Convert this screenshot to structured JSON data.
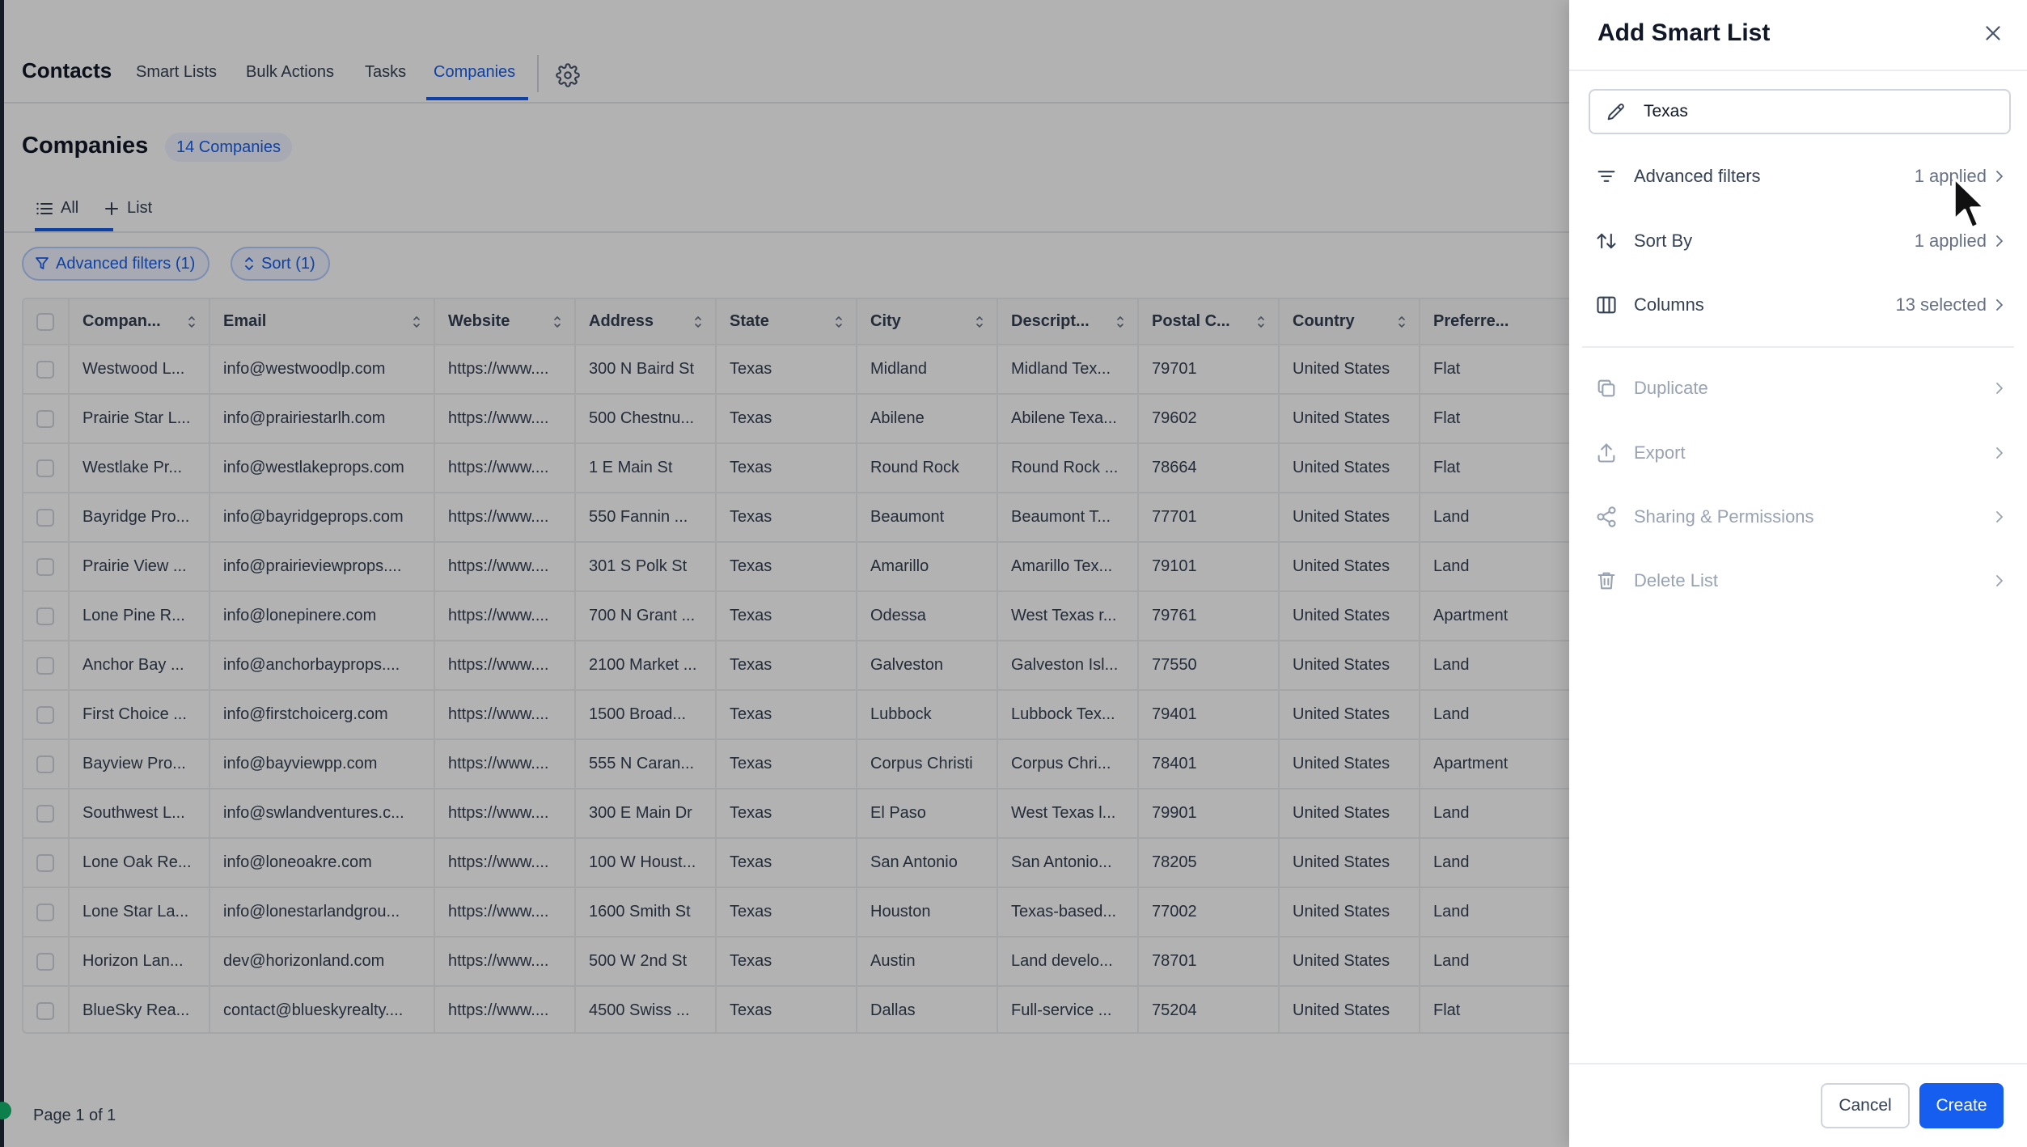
{
  "app": {
    "title": "Contacts",
    "nav_tabs": [
      "Smart Lists",
      "Bulk Actions",
      "Tasks",
      "Companies"
    ],
    "active_tab": "Companies",
    "settings_icon": "gear-icon"
  },
  "page": {
    "title": "Companies",
    "count_badge": "14 Companies"
  },
  "view_tabs": {
    "all_label": "All",
    "add_list_label": "List"
  },
  "toolbar": {
    "filters_label": "Advanced filters (1)",
    "sort_label": "Sort (1)"
  },
  "table": {
    "columns": [
      "Compan...",
      "Email",
      "Website",
      "Address",
      "State",
      "City",
      "Descript...",
      "Postal C...",
      "Country",
      "Preferre..."
    ],
    "rows": [
      [
        "Westwood L...",
        "info@westwoodlp.com",
        "https://www....",
        "300 N Baird St",
        "Texas",
        "Midland",
        "Midland Tex...",
        "79701",
        "United States",
        "Flat"
      ],
      [
        "Prairie Star L...",
        "info@prairiestarlh.com",
        "https://www....",
        "500 Chestnu...",
        "Texas",
        "Abilene",
        "Abilene Texa...",
        "79602",
        "United States",
        "Flat"
      ],
      [
        "Westlake Pr...",
        "info@westlakeprops.com",
        "https://www....",
        "1 E Main St",
        "Texas",
        "Round Rock",
        "Round Rock ...",
        "78664",
        "United States",
        "Flat"
      ],
      [
        "Bayridge Pro...",
        "info@bayridgeprops.com",
        "https://www....",
        "550 Fannin ...",
        "Texas",
        "Beaumont",
        "Beaumont T...",
        "77701",
        "United States",
        "Land"
      ],
      [
        "Prairie View ...",
        "info@prairieviewprops....",
        "https://www....",
        "301 S Polk St",
        "Texas",
        "Amarillo",
        "Amarillo Tex...",
        "79101",
        "United States",
        "Land"
      ],
      [
        "Lone Pine R...",
        "info@lonepinere.com",
        "https://www....",
        "700 N Grant ...",
        "Texas",
        "Odessa",
        "West Texas r...",
        "79761",
        "United States",
        "Apartment"
      ],
      [
        "Anchor Bay ...",
        "info@anchorbayprops....",
        "https://www....",
        "2100 Market ...",
        "Texas",
        "Galveston",
        "Galveston Isl...",
        "77550",
        "United States",
        "Land"
      ],
      [
        "First Choice ...",
        "info@firstchoicerg.com",
        "https://www....",
        "1500 Broad...",
        "Texas",
        "Lubbock",
        "Lubbock Tex...",
        "79401",
        "United States",
        "Land"
      ],
      [
        "Bayview Pro...",
        "info@bayviewpp.com",
        "https://www....",
        "555 N Caran...",
        "Texas",
        "Corpus Christi",
        "Corpus Chri...",
        "78401",
        "United States",
        "Apartment"
      ],
      [
        "Southwest L...",
        "info@swlandventures.c...",
        "https://www....",
        "300 E Main Dr",
        "Texas",
        "El Paso",
        "West Texas l...",
        "79901",
        "United States",
        "Land"
      ],
      [
        "Lone Oak Re...",
        "info@loneoakre.com",
        "https://www....",
        "100 W Houst...",
        "Texas",
        "San Antonio",
        "San Antonio...",
        "78205",
        "United States",
        "Land"
      ],
      [
        "Lone Star La...",
        "info@lonestarlandgrou...",
        "https://www....",
        "1600 Smith St",
        "Texas",
        "Houston",
        "Texas-based...",
        "77002",
        "United States",
        "Land"
      ],
      [
        "Horizon Lan...",
        "dev@horizonland.com",
        "https://www....",
        "500 W 2nd St",
        "Texas",
        "Austin",
        "Land develo...",
        "78701",
        "United States",
        "Land"
      ],
      [
        "BlueSky Rea...",
        "contact@blueskyrealty....",
        "https://www....",
        "4500 Swiss ...",
        "Texas",
        "Dallas",
        "Full-service ...",
        "75204",
        "United States",
        "Flat"
      ]
    ]
  },
  "pager": {
    "label": "Page 1 of 1"
  },
  "drawer": {
    "title": "Add Smart List",
    "name_value": "Texas",
    "items": [
      {
        "label": "Advanced filters",
        "value": "1 applied",
        "icon": "filter-lines-icon",
        "enabled": true
      },
      {
        "label": "Sort By",
        "value": "1 applied",
        "icon": "sort-arrows-icon",
        "enabled": true
      },
      {
        "label": "Columns",
        "value": "13 selected",
        "icon": "columns-icon",
        "enabled": true
      },
      {
        "label": "Duplicate",
        "value": "",
        "icon": "copy-icon",
        "enabled": false
      },
      {
        "label": "Export",
        "value": "",
        "icon": "export-icon",
        "enabled": false
      },
      {
        "label": "Sharing & Permissions",
        "value": "",
        "icon": "share-icon",
        "enabled": false
      },
      {
        "label": "Delete List",
        "value": "",
        "icon": "trash-icon",
        "enabled": false
      }
    ],
    "cancel_label": "Cancel",
    "create_label": "Create"
  },
  "colors": {
    "accent": "#155eef",
    "overlay": "rgba(0,0,0,0.30)",
    "text": "#344054",
    "disabled": "#98a2b3"
  }
}
